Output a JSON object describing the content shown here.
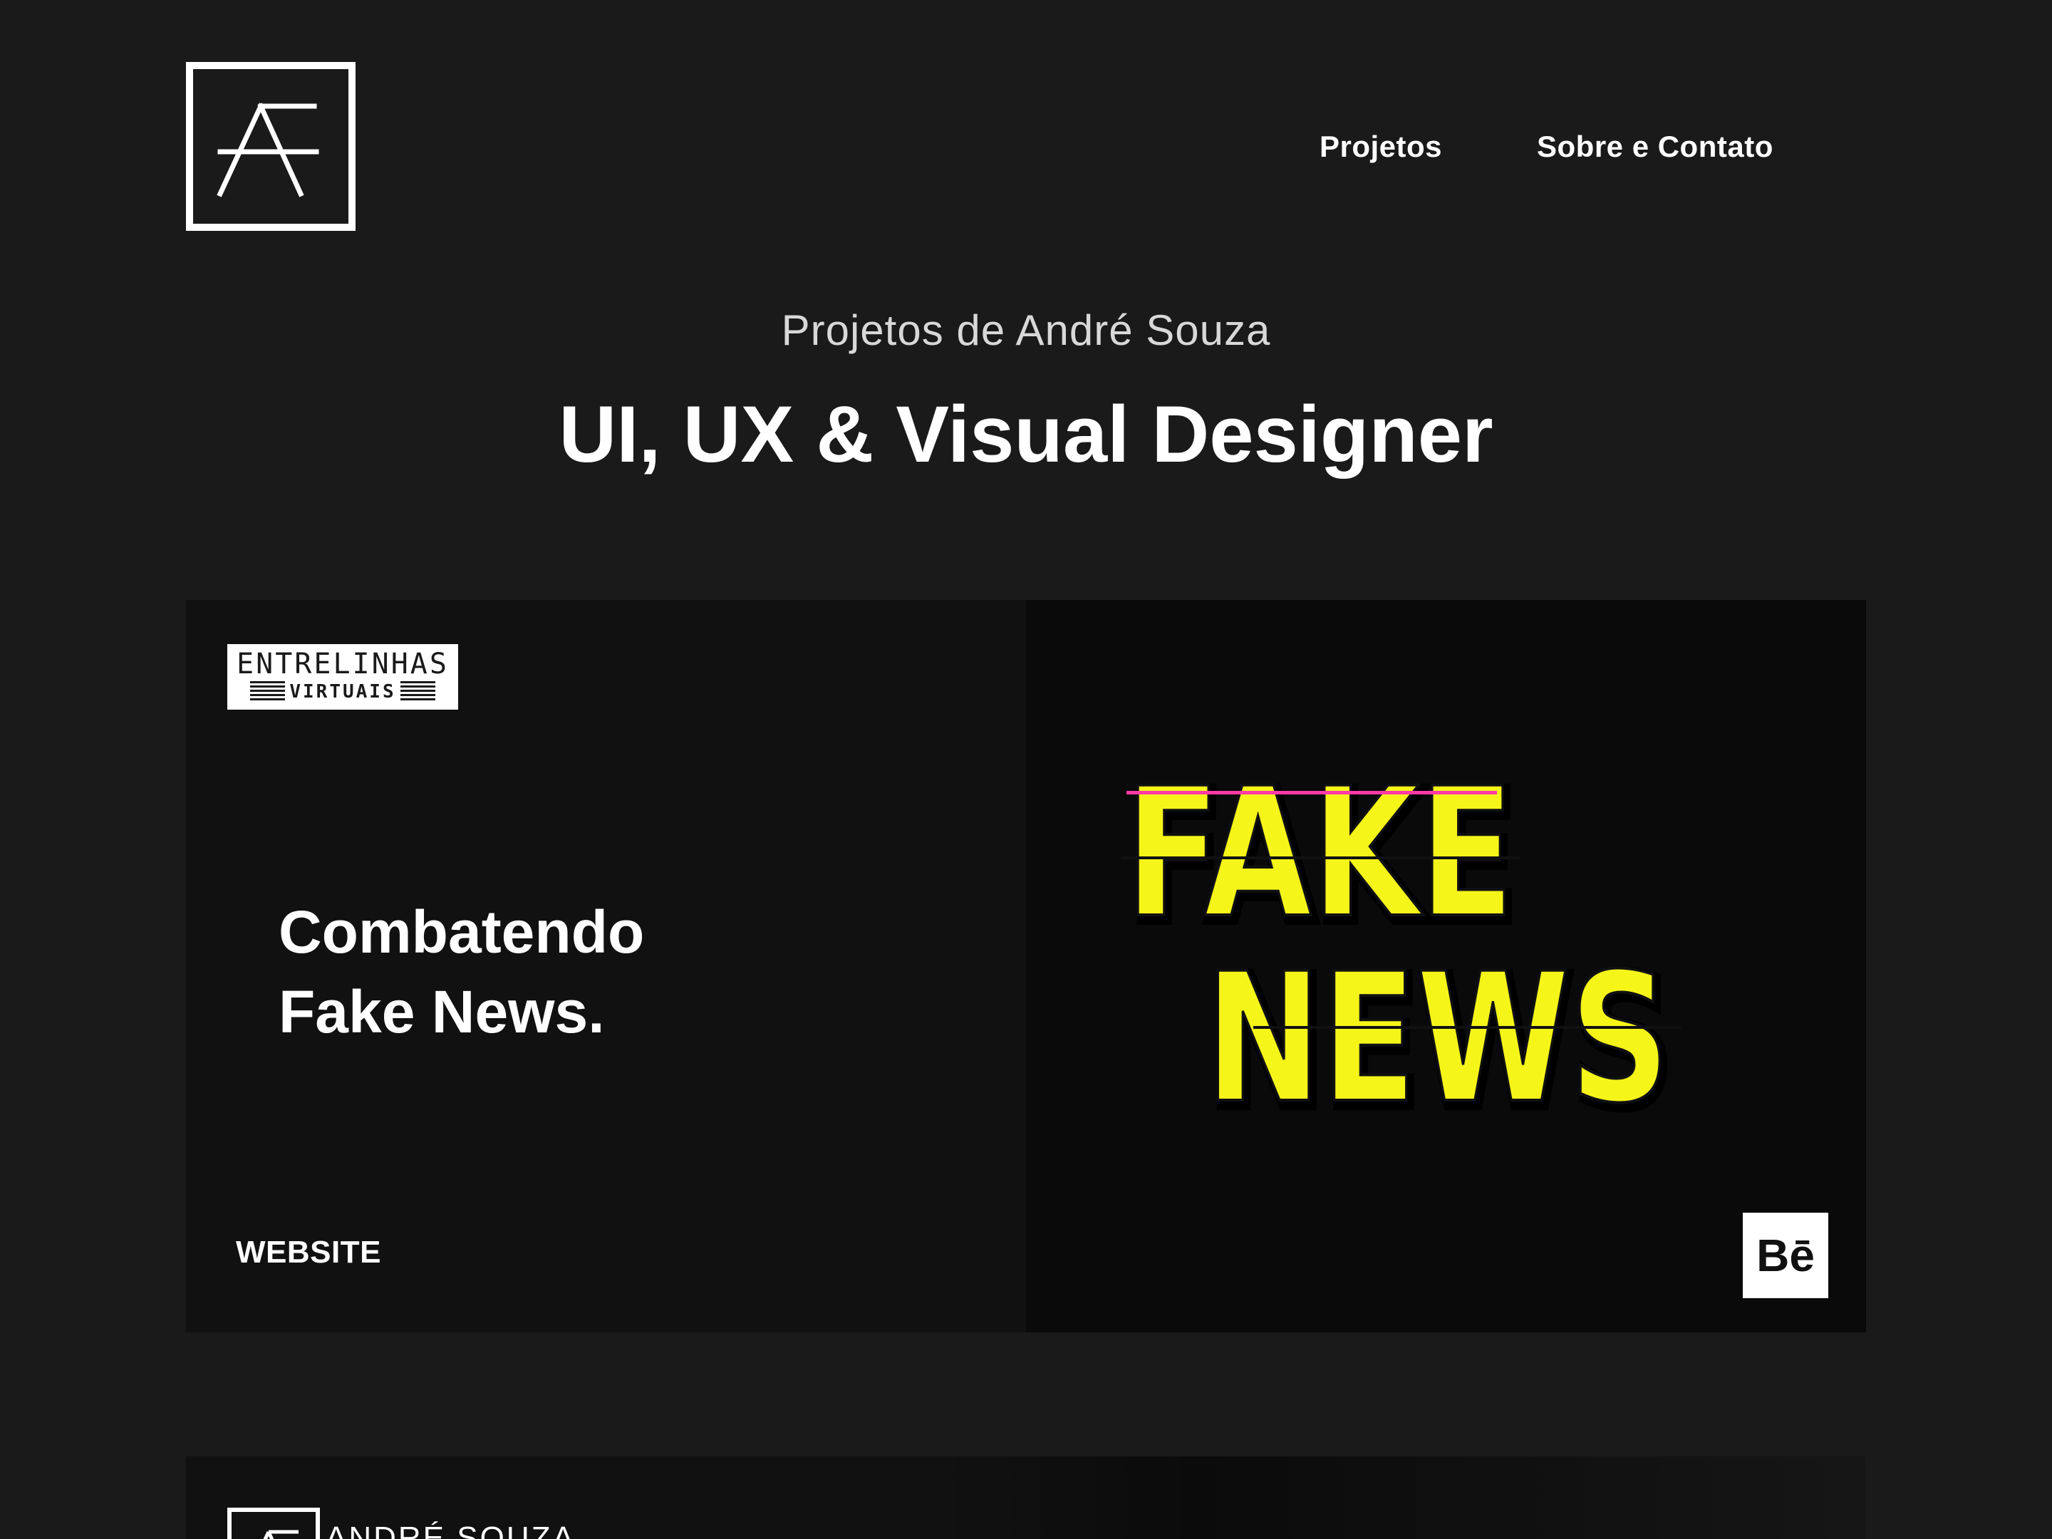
{
  "header": {
    "logo_icon": "monogram-ae-logo-icon",
    "nav": {
      "projetos": "Projetos",
      "sobre_contato": "Sobre e Contato"
    }
  },
  "hero": {
    "subtitle": "Projetos de André Souza",
    "title": "UI, UX & Visual Designer"
  },
  "projects": [
    {
      "brand_top": "ENTRELINHAS",
      "brand_bottom": "VIRTUAIS",
      "headline_line1": "Combatendo",
      "headline_line2": "Fake News.",
      "tag": "WEBSITE",
      "artwork_line1": "FAKE",
      "artwork_line2": "NEWS",
      "behance_icon_label": "Bē",
      "colors": {
        "artwork_yellow": "#f5f51a",
        "artwork_magenta": "#ff3aa8"
      }
    },
    {
      "brand": "ANDRÉ SOUZA"
    }
  ],
  "colors": {
    "page_background": "#1a1a1a",
    "card_background": "#111111",
    "text": "#ffffff"
  }
}
